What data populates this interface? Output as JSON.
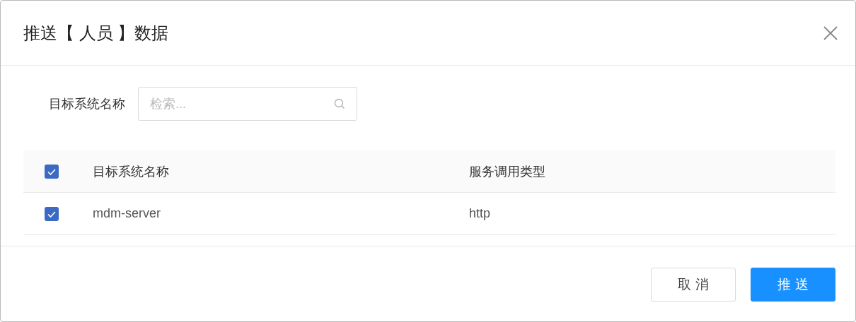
{
  "dialog": {
    "title": "推送【 人员 】数据"
  },
  "filter": {
    "label": "目标系统名称",
    "placeholder": "检索..."
  },
  "table": {
    "all_checked": true,
    "columns": [
      "目标系统名称",
      "服务调用类型"
    ],
    "rows": [
      {
        "checked": true,
        "cells": [
          "mdm-server",
          "http"
        ]
      }
    ]
  },
  "buttons": [
    {
      "label": "取 消",
      "kind": "default"
    },
    {
      "label": "推 送",
      "kind": "primary"
    }
  ]
}
